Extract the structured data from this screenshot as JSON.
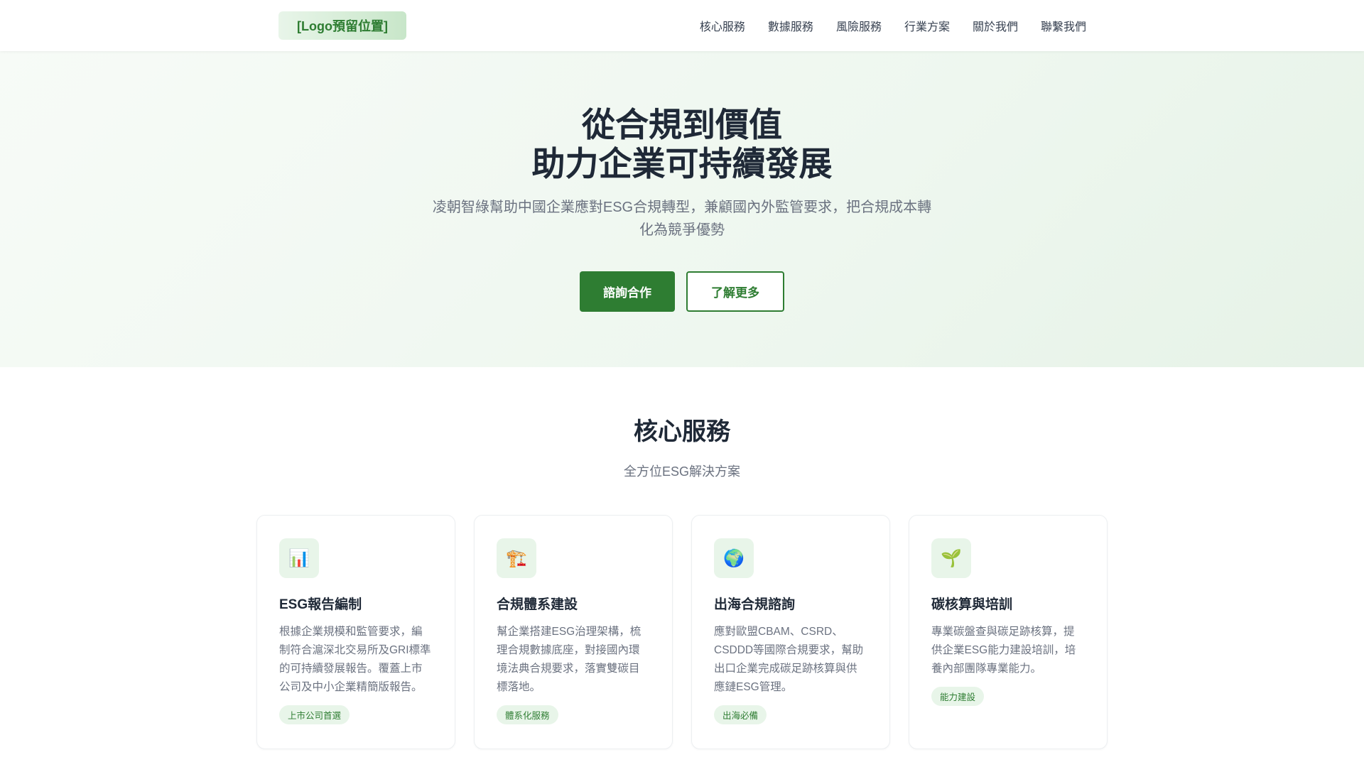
{
  "nav": {
    "logo": "[Logo預留位置]",
    "items": [
      "核心服務",
      "數據服務",
      "風險服務",
      "行業方案",
      "關於我們",
      "聯繫我們"
    ]
  },
  "hero": {
    "title_line1": "從合規到價值",
    "title_line2": "助力企業可持續發展",
    "subtitle": "凌朝智綠幫助中國企業應對ESG合規轉型，兼顧國內外監管要求，把合規成本轉化為競爭優勢",
    "primary_button": "諮詢合作",
    "secondary_button": "了解更多"
  },
  "services": {
    "title": "核心服務",
    "subtitle": "全方位ESG解決方案",
    "cards": [
      {
        "icon": "📊",
        "title": "ESG報告編制",
        "desc": "根據企業規模和監管要求，編制符合滬深北交易所及GRI標準的可持續發展報告。覆蓋上市公司及中小企業精簡版報告。",
        "tag": "上市公司首選"
      },
      {
        "icon": "🏗️",
        "title": "合規體系建設",
        "desc": "幫企業搭建ESG治理架構，梳理合規數據底座，對接國內環境法典合規要求，落實雙碳目標落地。",
        "tag": "體系化服務"
      },
      {
        "icon": "🌍",
        "title": "出海合規諮詢",
        "desc": "應對歐盟CBAM、CSRD、CSDDD等國際合規要求，幫助出口企業完成碳足跡核算與供應鏈ESG管理。",
        "tag": "出海必備"
      },
      {
        "icon": "🌱",
        "title": "碳核算與培訓",
        "desc": "專業碳盤查與碳足跡核算，提供企業ESG能力建設培訓，培養內部團隊專業能力。",
        "tag": "能力建設"
      }
    ]
  },
  "colors": {
    "brand": "#2e7d32",
    "tag_bg": "#e8f5e9"
  }
}
